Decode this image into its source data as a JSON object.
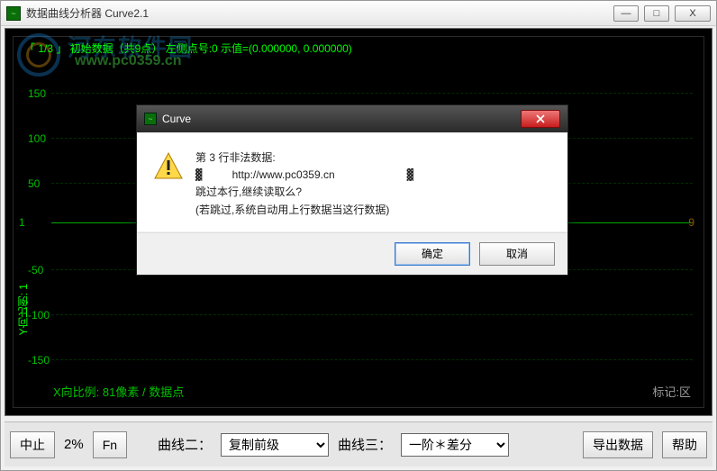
{
  "window": {
    "title": "数据曲线分析器 Curve2.1",
    "min": "—",
    "max": "□",
    "close": "X"
  },
  "watermark": {
    "line1": "河东软件园",
    "line2": "www.pc0359.cn"
  },
  "header_status": "「 1/3 」 初始数据（共9点） 左侧点号:0  示值=(0.000000, 0.000000)",
  "yaxis": {
    "title": "Y向比例: 1",
    "ticks": [
      "150",
      "100",
      "50",
      "-50",
      "-100",
      "-150"
    ],
    "right_value": "9",
    "left_value": "1"
  },
  "xinfo": "X向比例: 81像素 / 数据点",
  "marker_label": "标记:区",
  "toolbar": {
    "abort": "中止",
    "percent": "2%",
    "fn": "Fn",
    "curve2_label": "曲线二：",
    "curve2_value": "复制前级",
    "curve3_label": "曲线三：",
    "curve3_value": "一阶＊差分",
    "export": "导出数据",
    "help": "帮助"
  },
  "dialog": {
    "title": "Curve",
    "line1": "第 3 行非法数据:",
    "garbled_a": "▓",
    "url": "http://www.pc0359.cn",
    "garbled_b": "▓",
    "line2": "跳过本行,继续读取么?",
    "line3": "(若跳过,系统自动用上行数据当这行数据)",
    "ok": "确定",
    "cancel": "取消"
  },
  "chart_data": {
    "type": "line",
    "title": "",
    "xlabel": "X向比例: 81像素 / 数据点",
    "ylabel": "Y向比例: 1",
    "ylim": [
      -175,
      175
    ],
    "xlim": [
      1,
      9
    ],
    "yticks": [
      -150,
      -100,
      -50,
      0,
      50,
      100,
      150
    ],
    "series": [
      {
        "name": "初始数据",
        "x": [
          1,
          2,
          3,
          4,
          5,
          6,
          7,
          8,
          9
        ],
        "y": [
          0,
          0,
          0,
          0,
          0,
          0,
          0,
          0,
          0
        ]
      }
    ],
    "annotations": [
      "左侧点号:0",
      "示值=(0.000000, 0.000000)"
    ]
  }
}
